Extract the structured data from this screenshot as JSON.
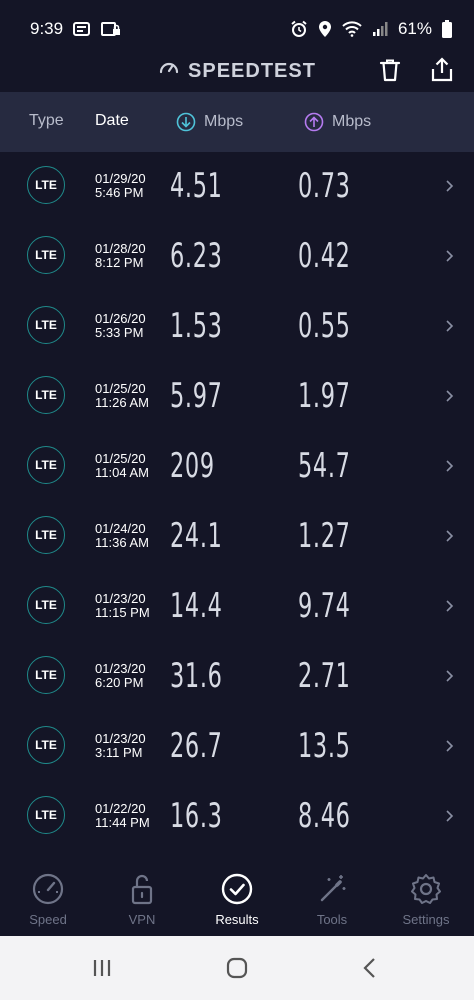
{
  "status_bar": {
    "time": "9:39",
    "battery": "61%"
  },
  "app": {
    "title": "SPEEDTEST"
  },
  "columns": {
    "type": "Type",
    "date": "Date",
    "download": "Mbps",
    "upload": "Mbps"
  },
  "results": [
    {
      "type": "LTE",
      "date": "01/29/20",
      "time": "5:46 PM",
      "download": "4.51",
      "upload": "0.73"
    },
    {
      "type": "LTE",
      "date": "01/28/20",
      "time": "8:12 PM",
      "download": "6.23",
      "upload": "0.42"
    },
    {
      "type": "LTE",
      "date": "01/26/20",
      "time": "5:33 PM",
      "download": "1.53",
      "upload": "0.55"
    },
    {
      "type": "LTE",
      "date": "01/25/20",
      "time": "11:26 AM",
      "download": "5.97",
      "upload": "1.97"
    },
    {
      "type": "LTE",
      "date": "01/25/20",
      "time": "11:04 AM",
      "download": "209",
      "upload": "54.7"
    },
    {
      "type": "LTE",
      "date": "01/24/20",
      "time": "11:36 AM",
      "download": "24.1",
      "upload": "1.27"
    },
    {
      "type": "LTE",
      "date": "01/23/20",
      "time": "11:15 PM",
      "download": "14.4",
      "upload": "9.74"
    },
    {
      "type": "LTE",
      "date": "01/23/20",
      "time": "6:20 PM",
      "download": "31.6",
      "upload": "2.71"
    },
    {
      "type": "LTE",
      "date": "01/23/20",
      "time": "3:11 PM",
      "download": "26.7",
      "upload": "13.5"
    },
    {
      "type": "LTE",
      "date": "01/22/20",
      "time": "11:44 PM",
      "download": "16.3",
      "upload": "8.46"
    }
  ],
  "nav": {
    "speed": "Speed",
    "vpn": "VPN",
    "results": "Results",
    "tools": "Tools",
    "settings": "Settings",
    "active": "results"
  },
  "colors": {
    "background": "#141526",
    "header_bar": "#262a40",
    "download_accent": "#4fc3d9",
    "upload_accent": "#b57bf0",
    "lte_ring": "#1f8a8a"
  }
}
